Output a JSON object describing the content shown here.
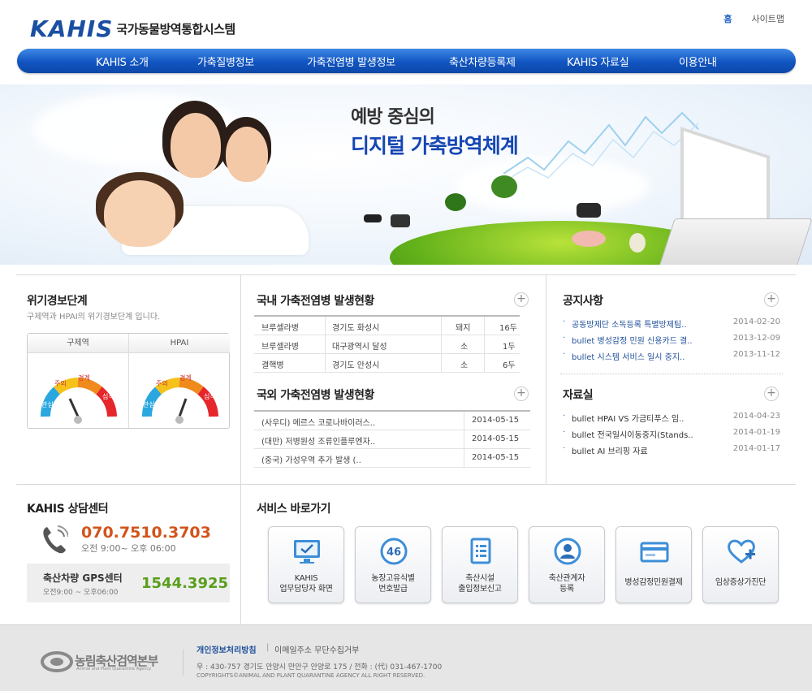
{
  "header": {
    "logo_text": "KAHIS",
    "system_name": "국가동물방역통합시스템",
    "home_link": "홈",
    "sitemap_link": "사이트맵"
  },
  "nav": [
    "KAHIS 소개",
    "가축질병정보",
    "가축전염병 발생정보",
    "축산차량등록제",
    "KAHIS 자료실",
    "이용안내"
  ],
  "hero": {
    "line1": "예방 중심의",
    "line2": "디지털 가축방역체계"
  },
  "risk": {
    "title": "위기경보단계",
    "desc": "구제역과 HPAI의 위기경보단계 입니다.",
    "gauges": [
      {
        "name": "구제역",
        "levels": [
          "관심",
          "주의",
          "경계",
          "심각"
        ],
        "active_level": "관심"
      },
      {
        "name": "HPAI",
        "levels": [
          "관심",
          "주의",
          "경계",
          "심각"
        ],
        "active_level": "경계"
      }
    ]
  },
  "domestic": {
    "title": "국내 가축전염병 발생현황",
    "rows": [
      {
        "disease": "브루셀라병",
        "region": "경기도 화성시",
        "animal": "돼지",
        "count": "16두"
      },
      {
        "disease": "브루셀라병",
        "region": "대구광역시 달성",
        "animal": "소",
        "count": "1두"
      },
      {
        "disease": "결핵병",
        "region": "경기도 안성시",
        "animal": "소",
        "count": "6두"
      }
    ]
  },
  "overseas": {
    "title": "국외 가축전염병 발생현황",
    "rows": [
      {
        "title": "(사우디) 메르스 코로나바이러스..",
        "date": "2014-05-15"
      },
      {
        "title": "(대만) 저병원성 조류인플루엔자..",
        "date": "2014-05-15"
      },
      {
        "title": "(중국) 가성우역 추가 발생 (..",
        "date": "2014-05-15"
      }
    ]
  },
  "notice": {
    "title": "공지사항",
    "items": [
      {
        "title": "공동방제단 소독등록 특별방제팀..",
        "date": "2014-02-20"
      },
      {
        "title": "bullet 병성감정 민원 신용카드 결..",
        "date": "2013-12-09"
      },
      {
        "title": "bullet 시스템 서비스 일시 중지..",
        "date": "2013-11-12"
      }
    ]
  },
  "library": {
    "title": "자료실",
    "items": [
      {
        "title": "bullet  HPAI VS 가금티푸스 임..",
        "date": "2014-04-23"
      },
      {
        "title": "bullet 전국일시이동중지(Stands..",
        "date": "2014-01-19"
      },
      {
        "title": "bullet  AI 브리핑 자료",
        "date": "2014-01-17"
      }
    ]
  },
  "counsel": {
    "title": "KAHIS 상담센터",
    "phone": "070.7510.3703",
    "hours": "오전 9:00~  오후 06:00",
    "gps_title": "축산차량 GPS센터",
    "gps_hours": "오전9:00 ~ 오후06:00",
    "gps_phone": "1544.3925"
  },
  "services": {
    "title": "서비스 바로가기",
    "tiles": [
      {
        "line1": "KAHIS",
        "line2": "업무담당자 화면",
        "icon": "monitor-check-icon"
      },
      {
        "line1": "농장고유식별",
        "line2": "번호발급",
        "icon": "number-badge-icon",
        "badge": "46"
      },
      {
        "line1": "축산시설",
        "line2": "출입정보신고",
        "icon": "document-list-icon"
      },
      {
        "line1": "축산관계자",
        "line2": "등록",
        "icon": "person-icon"
      },
      {
        "line1": "병성감정민원결제",
        "line2": "",
        "icon": "credit-card-icon"
      },
      {
        "line1": "임상증상가진단",
        "line2": "",
        "icon": "heart-plus-icon"
      }
    ]
  },
  "footer": {
    "org_name": "농림축산검역본부",
    "org_name_en": "Animal and Plant Quarantine Agency",
    "privacy_link": "개인정보처리방침",
    "email_link": "이메일주소 무단수집거부",
    "address": "우 : 430-757 경기도 안양시 만안구 안양로 175 / 전화 : (代) 031-467-1700",
    "copyright": "COPYRIGHTS©ANIMAL AND PLANT QUARANTINE AGENCY ALL RIGHT RESERVED."
  },
  "colors": {
    "nav_blue": "#1155c2",
    "accent_orange": "#d2541b",
    "accent_green": "#5a9e1c",
    "link_blue": "#1f4f9a"
  }
}
